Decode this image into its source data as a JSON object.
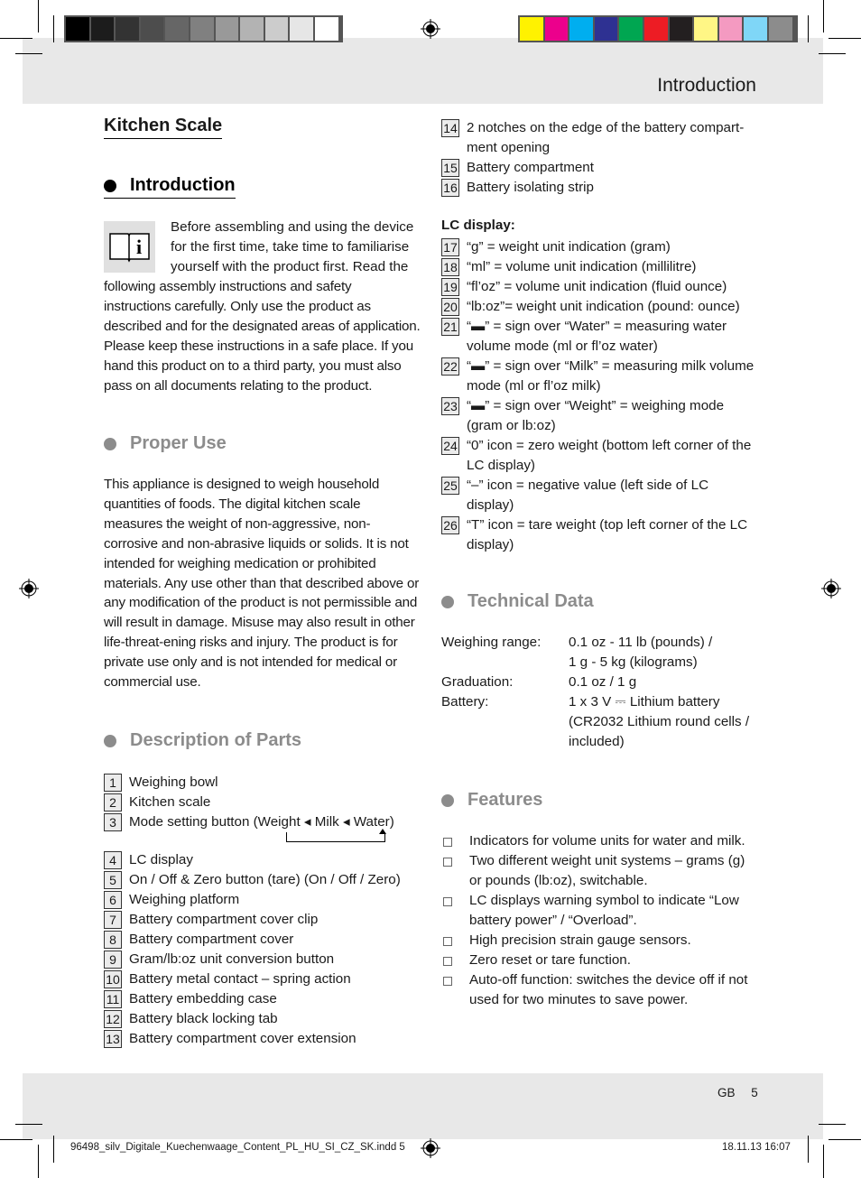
{
  "color_bars": {
    "grayscale": [
      "#000000",
      "#1c1c1c",
      "#333333",
      "#4d4d4d",
      "#666666",
      "#808080",
      "#999999",
      "#b3b3b3",
      "#cccccc",
      "#e6e6e6",
      "#ffffff"
    ],
    "process": [
      "#fff200",
      "#ec008c",
      "#00aeef",
      "#2e3192",
      "#00a651",
      "#ed1c24",
      "#231f20",
      "#fff685",
      "#f49ac1",
      "#7fd6f7",
      "#8c8c8c"
    ]
  },
  "header": {
    "title": "Introduction"
  },
  "left": {
    "main_title": "Kitchen Scale",
    "introduction": {
      "heading": "Introduction",
      "icon": "manual-info-icon",
      "lines_indented": [
        "Before assembling and using the device",
        "for the first time, take time to familiarise",
        "yourself with the product first. Read the"
      ],
      "text_rest": "following assembly instructions and safety instructions carefully. Only use the product as described and for the designated areas of application. Please keep these instructions in a safe place. If you hand this product on to a third party, you must also pass on all documents relating to the product."
    },
    "proper_use": {
      "heading": "Proper Use",
      "text": "This appliance is designed to weigh household quantities of foods. The digital kitchen scale measures the weight of non-aggressive, non-corrosive and non-abrasive liquids or solids. It is not intended for weighing medication or prohibited materials. Any use other than that described above or any modification of the product is not permissible and will result in damage. Misuse may also result in other life-threat-ening risks and injury. The product is for private use only and is not intended for medical or commercial use."
    },
    "parts": {
      "heading": "Description of Parts",
      "group1": [
        {
          "n": "1",
          "label": "Weighing bowl"
        },
        {
          "n": "2",
          "label": "Kitchen scale"
        },
        {
          "n": "3",
          "label": "Mode setting button (Weight ◂ Milk ◂ Water)"
        }
      ],
      "group2": [
        {
          "n": "4",
          "label": "LC display"
        },
        {
          "n": "5",
          "label": "On / Off & Zero button (tare) (On / Off / Zero)"
        },
        {
          "n": "6",
          "label": "Weighing platform"
        },
        {
          "n": "7",
          "label": "Battery compartment cover clip"
        },
        {
          "n": "8",
          "label": "Battery compartment cover"
        },
        {
          "n": "9",
          "label": "Gram/lb:oz unit conversion button"
        },
        {
          "n": "10",
          "label": "Battery metal contact – spring action"
        },
        {
          "n": "11",
          "label": "Battery embedding case"
        },
        {
          "n": "12",
          "label": "Battery black locking tab"
        },
        {
          "n": "13",
          "label": "Battery compartment cover extension"
        }
      ]
    }
  },
  "right": {
    "parts_cont": [
      {
        "n": "14",
        "label": "2 notches on the edge of the battery compart-ment opening"
      },
      {
        "n": "15",
        "label": "Battery compartment"
      },
      {
        "n": "16",
        "label": "Battery isolating strip"
      }
    ],
    "lc_display": {
      "label": "LC display:",
      "items": [
        {
          "n": "17",
          "label": "“g” = weight unit indication (gram)"
        },
        {
          "n": "18",
          "label": "“ml” = volume unit indication (millilitre)"
        },
        {
          "n": "19",
          "label": "“fl’oz” = volume unit indication (fluid ounce)"
        },
        {
          "n": "20",
          "label": "“lb:oz”= weight unit indication (pound: ounce)"
        },
        {
          "n": "21",
          "label": "“▬” = sign over “Water” = measuring water volume mode (ml or fl’oz water)"
        },
        {
          "n": "22",
          "label": "“▬” = sign over “Milk” = measuring milk volume mode (ml or fl’oz milk)"
        },
        {
          "n": "23",
          "label": "“▬” = sign over “Weight” = weighing mode (gram or lb:oz)"
        },
        {
          "n": "24",
          "label": "“0” icon = zero weight (bottom left corner of the LC display)"
        },
        {
          "n": "25",
          "label": "“–” icon = negative value (left side of LC display)"
        },
        {
          "n": "26",
          "label": "“T” icon = tare weight (top left corner of the LC display)"
        }
      ]
    },
    "technical": {
      "heading": "Technical Data",
      "rows": [
        {
          "k": "Weighing range:",
          "v": "0.1 oz - 11 lb (pounds) /",
          "v2": "1 g - 5 kg (kilograms)"
        },
        {
          "k": "Graduation:",
          "v": "0.1 oz / 1 g"
        },
        {
          "k": "Battery:",
          "v": "1 x 3 V ⎓ Lithium battery",
          "v2": "(CR2032 Lithium round cells /",
          "v3": "included)"
        }
      ]
    },
    "features": {
      "heading": "Features",
      "items": [
        "Indicators for volume units for water and milk.",
        "Two different weight unit systems – grams (g) or pounds (lb:oz), switchable.",
        "LC displays warning symbol to indicate “Low battery power” / “Overload”.",
        "High precision strain gauge sensors.",
        "Zero reset or tare function.",
        "Auto-off function: switches the device off if not used for two minutes to save power."
      ]
    }
  },
  "footer": {
    "page_label": "GB",
    "page_number": "5",
    "file": "96498_silv_Digitale_Kuechenwaage_Content_PL_HU_SI_CZ_SK.indd   5",
    "date": "18.11.13   16:07"
  }
}
